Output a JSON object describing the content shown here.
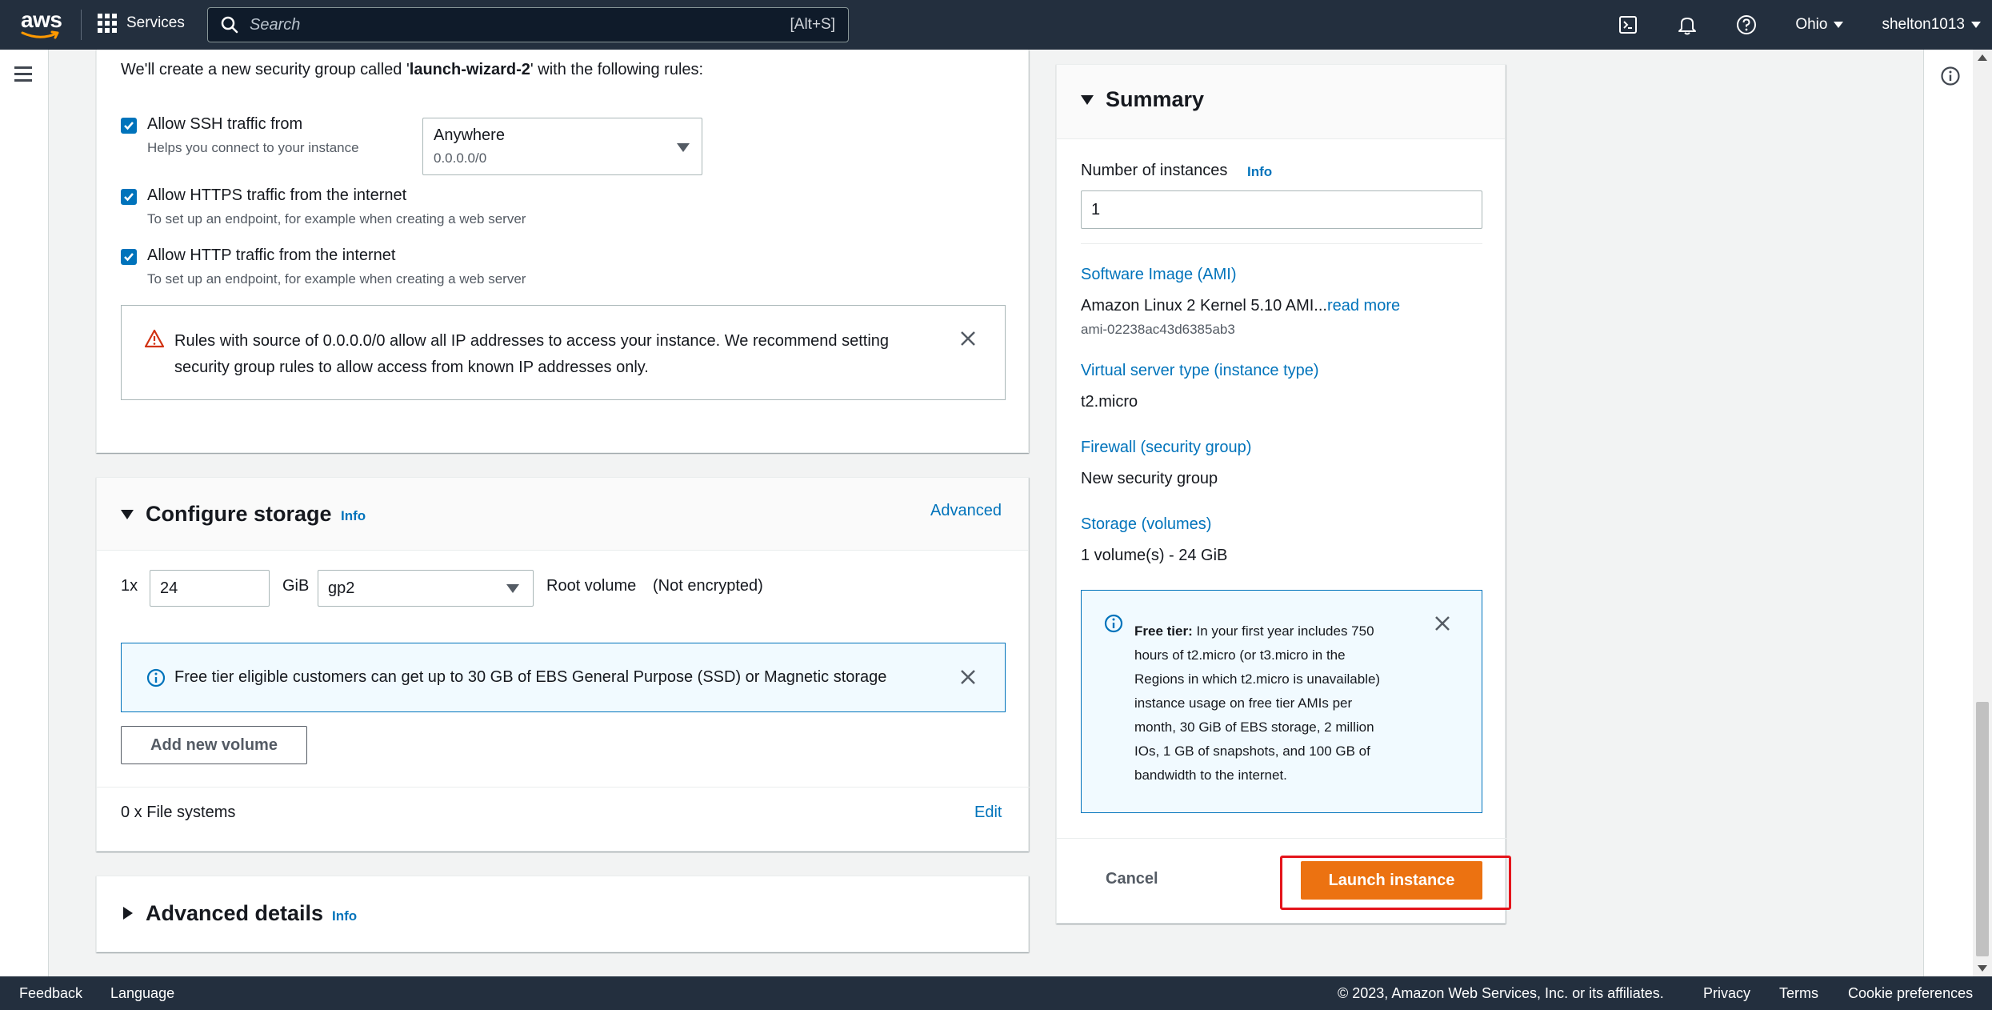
{
  "nav": {
    "logo": "aws",
    "services": "Services",
    "search_placeholder": "Search",
    "search_shortcut": "[Alt+S]",
    "region": "Ohio",
    "user": "shelton1013",
    "icons": [
      "cloudshell-icon",
      "notifications-icon",
      "help-icon"
    ]
  },
  "security": {
    "intro_prefix": "We'll create a new security group called '",
    "intro_name": "launch-wizard-2",
    "intro_suffix": "' with the following rules:",
    "ssh_label": "Allow SSH traffic from",
    "ssh_desc": "Helps you connect to your instance",
    "ssh_source_value": "Anywhere",
    "ssh_source_sub": "0.0.0.0/0",
    "https_label": "Allow HTTPS traffic from the internet",
    "https_desc": "To set up an endpoint, for example when creating a web server",
    "http_label": "Allow HTTP traffic from the internet",
    "http_desc": "To set up an endpoint, for example when creating a web server",
    "warning_line1": "Rules with source of 0.0.0.0/0 allow all IP addresses to access your instance. We recommend setting",
    "warning_line2": "security group rules to allow access from known IP addresses only."
  },
  "storage": {
    "title": "Configure storage",
    "info": "Info",
    "advanced": "Advanced",
    "count_prefix": "1x",
    "size_value": "24",
    "unit": "GiB",
    "volume_type": "gp2",
    "root_volume": "Root volume",
    "encryption": "(Not encrypted)",
    "free_tier_note": "Free tier eligible customers can get up to 30 GB of EBS General Purpose (SSD) or Magnetic storage",
    "add_volume": "Add new volume",
    "file_systems": "0 x File systems",
    "edit": "Edit"
  },
  "advanced_details": {
    "title": "Advanced details",
    "info": "Info"
  },
  "summary": {
    "title": "Summary",
    "num_instances_label": "Number of instances",
    "info": "Info",
    "num_instances_value": "1",
    "ami_label": "Software Image (AMI)",
    "ami_value": "Amazon Linux 2 Kernel 5.10 AMI...",
    "read_more": "read more",
    "ami_id": "ami-02238ac43d6385ab3",
    "type_label": "Virtual server type (instance type)",
    "type_value": "t2.micro",
    "firewall_label": "Firewall (security group)",
    "firewall_value": "New security group",
    "storage_label": "Storage (volumes)",
    "storage_value": "1 volume(s) - 24 GiB",
    "free_tier_bold": "Free tier:",
    "free_tier_lines": [
      "In your first year includes 750",
      "hours of t2.micro (or t3.micro in the",
      "Regions in which t2.micro is unavailable)",
      "instance usage on free tier AMIs per",
      "month, 30 GiB of EBS storage, 2 million",
      "IOs, 1 GB of snapshots, and 100 GB of",
      "bandwidth to the internet."
    ],
    "cancel": "Cancel",
    "launch": "Launch instance"
  },
  "footer": {
    "feedback": "Feedback",
    "language": "Language",
    "copyright": "© 2023, Amazon Web Services, Inc. or its affiliates.",
    "privacy": "Privacy",
    "terms": "Terms",
    "cookies": "Cookie preferences"
  },
  "colors": {
    "nav_bg": "#232f3e",
    "link": "#0073bb",
    "primary_button": "#ec7211",
    "highlight": "#e4141b",
    "warning": "#d13212"
  }
}
